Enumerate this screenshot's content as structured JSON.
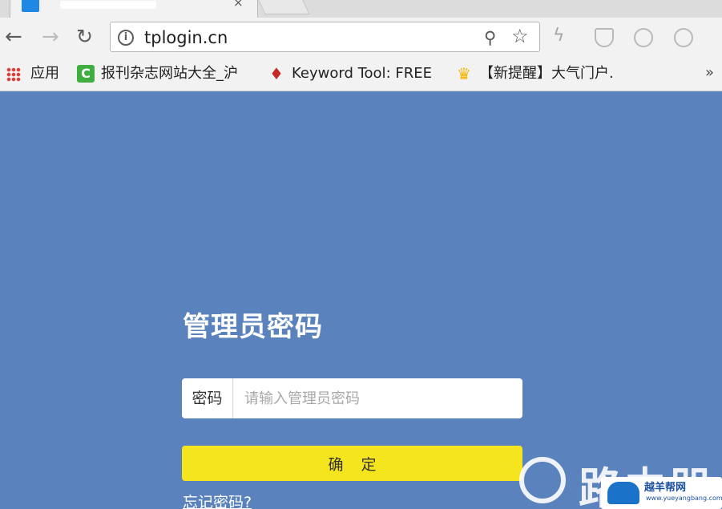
{
  "browser": {
    "address_url": "tplogin.cn"
  },
  "bookmarks": {
    "apps_label": "应用",
    "items": [
      {
        "label": "报刊杂志网站大全_沪",
        "icon": "refresh-c-icon"
      },
      {
        "label": "Keyword Tool: FREE",
        "icon": "flame-icon"
      },
      {
        "label": "【新提醒】大气门户.",
        "icon": "trophy-icon"
      }
    ],
    "more": "»"
  },
  "login": {
    "title": "管理员密码",
    "password_label": "密码",
    "password_placeholder": "请输入管理员密码",
    "confirm_label": "确定",
    "forgot_link": "忘记密码?"
  },
  "watermark": {
    "big_text": "路由器",
    "badge_text": "越羊帮网",
    "badge_url": "www.yueyangbang.com"
  },
  "colors": {
    "page_bg": "#5a82bd",
    "confirm_button": "#f5e51f"
  }
}
